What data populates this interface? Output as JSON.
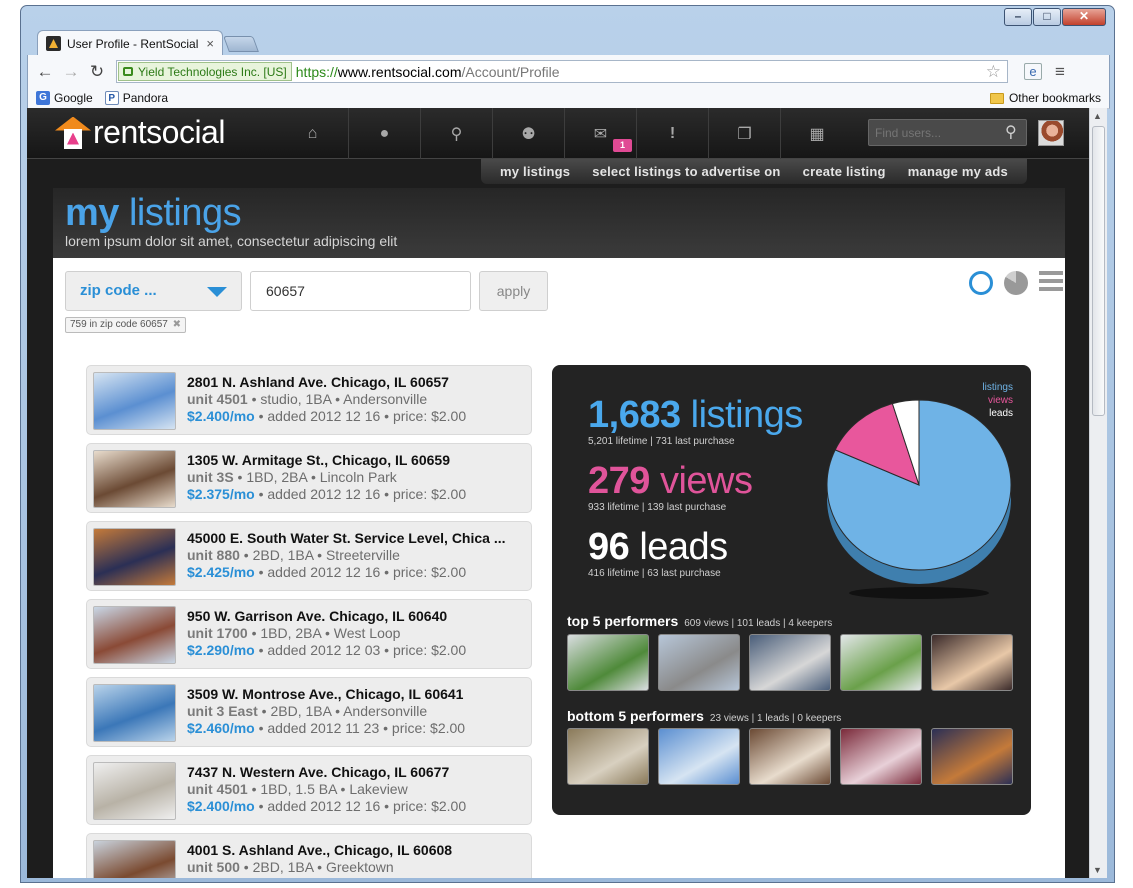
{
  "browser": {
    "tab_title": "User Profile - RentSocial",
    "tab_close": "×",
    "ev_label": "Yield Technologies Inc. [US]",
    "url_scheme": "https://",
    "url_host": "www.rentsocial.com",
    "url_path": "/Account/Profile",
    "bookmarks": [
      {
        "label": "Google",
        "icon": "G"
      },
      {
        "label": "Pandora",
        "icon": "P"
      }
    ],
    "other_bookmarks": "Other bookmarks"
  },
  "site": {
    "logo_text": "rentsocial",
    "find_users_placeholder": "Find users...",
    "message_count": "1",
    "nav_icons": [
      "home-icon",
      "user-icon",
      "search-icon",
      "friends-icon",
      "messages-icon",
      "alerts-icon",
      "listings-icon",
      "grid-icon"
    ],
    "subnav": [
      "my listings",
      "select listings to advertise on",
      "create listing",
      "manage my ads"
    ]
  },
  "hero": {
    "title_bold": "my",
    "title_rest": " listings",
    "subtitle": "lorem ipsum dolor sit amet, consectetur adipiscing elit"
  },
  "filter": {
    "select_value": "zip code ...",
    "zip_value": "60657",
    "apply_label": "apply",
    "tag": "759 in zip code 60657",
    "tag_close": "✖"
  },
  "listings": [
    {
      "address": "2801 N. Ashland Ave. Chicago, IL 60657",
      "unit": "unit 4501",
      "details": " • studio, 1BA • Andersonville",
      "price": "$2.400/mo",
      "meta": " • added 2012 12 16 • price: $2.00",
      "colors": [
        "#5b8fd1",
        "#d6e4f2"
      ]
    },
    {
      "address": "1305 W. Armitage St., Chicago, IL 60659",
      "unit": "unit 3S",
      "details": " • 1BD, 2BA • Lincoln Park",
      "price": "$2.375/mo",
      "meta": " • added 2012 12 16 • price: $2.00",
      "colors": [
        "#6b4a34",
        "#e8dccd"
      ]
    },
    {
      "address": "45000 E. South Water St. Service Level, Chica ...",
      "unit": "unit 880",
      "details": " • 2BD, 1BA • Streeterville",
      "price": "$2.425/mo",
      "meta": " • added 2012 12 16 • price: $2.00",
      "colors": [
        "#2b2f55",
        "#c47a3a"
      ]
    },
    {
      "address": "950 W. Garrison Ave. Chicago, IL 60640",
      "unit": "unit 1700",
      "details": " • 1BD, 2BA • West Loop",
      "price": "$2.290/mo",
      "meta": " • added 2012 12 03 • price: $2.00",
      "colors": [
        "#8a4a36",
        "#c9d7e6"
      ]
    },
    {
      "address": "3509 W. Montrose Ave., Chicago, IL 60641",
      "unit": "unit 3 East",
      "details": " • 2BD, 1BA • Andersonville",
      "price": "$2.460/mo",
      "meta": " • added 2012 11 23 • price: $2.00",
      "colors": [
        "#3b77b8",
        "#b9d3ea"
      ]
    },
    {
      "address": "7437 N. Western Ave. Chicago, IL 60677",
      "unit": "unit 4501",
      "details": " • 1BD, 1.5 BA • Lakeview",
      "price": "$2.400/mo",
      "meta": " • added 2012 12 16 • price: $2.00",
      "colors": [
        "#b8b2a6",
        "#efefef"
      ]
    },
    {
      "address": "4001 S. Ashland Ave., Chicago, IL 60608",
      "unit": "unit 500",
      "details": " • 2BD, 1BA • Greektown",
      "price": "",
      "meta": "",
      "colors": [
        "#7a4a30",
        "#c9d2dc"
      ]
    }
  ],
  "stats": {
    "listings": {
      "num": "1,683",
      "word": " listings",
      "sub": "5,201 lifetime | 731 last purchase"
    },
    "views": {
      "num": "279",
      "word": " views",
      "sub": "933 lifetime | 139 last purchase"
    },
    "leads": {
      "num": "96",
      "word": " leads",
      "sub": "416 lifetime | 63 last purchase"
    },
    "legend": [
      {
        "label": "listings",
        "color": "#6fb3e6"
      },
      {
        "label": "views",
        "color": "#e8579c"
      },
      {
        "label": "leads",
        "color": "#ffffff"
      }
    ],
    "top": {
      "title": "top 5 performers",
      "summary": "609 views | 101 leads | 4 keepers",
      "thumbs": [
        [
          "#d9dde0",
          "#4f8a3a"
        ],
        [
          "#b7c6d8",
          "#8a8a8a"
        ],
        [
          "#4a5e7a",
          "#d7d7d7"
        ],
        [
          "#e2e6e8",
          "#6aa04a"
        ],
        [
          "#3a2a2a",
          "#e8c8a8"
        ]
      ]
    },
    "bottom": {
      "title": "bottom 5 performers",
      "summary": "23 views | 1 leads | 0 keepers",
      "thumbs": [
        [
          "#8a7a5a",
          "#d8d0c0"
        ],
        [
          "#5b8fd1",
          "#d6e4f2"
        ],
        [
          "#6b4a34",
          "#e8dccd"
        ],
        [
          "#7a2a3a",
          "#e8d0d8"
        ],
        [
          "#2b2f55",
          "#c47a3a"
        ]
      ]
    }
  },
  "chart_data": {
    "type": "pie",
    "categories": [
      "listings",
      "views",
      "leads"
    ],
    "values": [
      1683,
      279,
      96
    ],
    "legend_position": "top-right"
  }
}
